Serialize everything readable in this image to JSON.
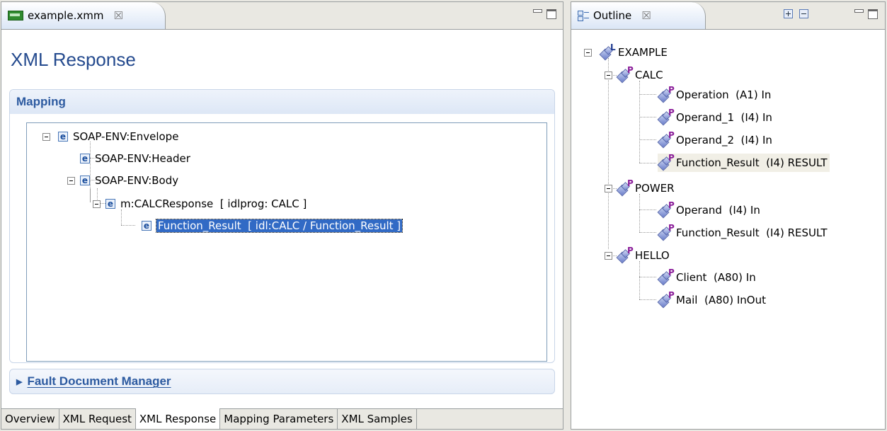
{
  "editor": {
    "tab_title": "example.xmm",
    "file_icon": "xml-mapping-file-icon",
    "form_title": "XML Response",
    "mapping_section": "Mapping",
    "fault_section": "Fault Document Manager",
    "tree": [
      {
        "label": "SOAP-ENV:Envelope"
      },
      {
        "label": "SOAP-ENV:Header"
      },
      {
        "label": "SOAP-ENV:Body"
      },
      {
        "label": "m:CALCResponse  [ idlprog: CALC ]"
      },
      {
        "label": "Function_Result  [ idl:CALC / Function_Result ]"
      }
    ],
    "bottom_tabs": [
      "Overview",
      "XML Request",
      "XML Response",
      "Mapping Parameters",
      "XML Samples"
    ],
    "active_bottom_tab": "XML Response"
  },
  "outline": {
    "tab_title": "Outline",
    "root": "EXAMPLE",
    "items": {
      "calc": "CALC",
      "calc_op": "Operation  (A1) In",
      "calc_o1": "Operand_1  (I4) In",
      "calc_o2": "Operand_2  (I4) In",
      "calc_fr": "Function_Result  (I4) RESULT",
      "power": "POWER",
      "power_op": "Operand  (I4) In",
      "power_fr": "Function_Result  (I4) RESULT",
      "hello": "HELLO",
      "hello_client": "Client  (A80) In",
      "hello_mail": "Mail  (A80) InOut"
    },
    "badges": {
      "library": "L",
      "program": "P"
    }
  },
  "colors": {
    "title": "#244a8e",
    "section_header": "#2c5aa0",
    "selection": "#316ac5",
    "program_badge": "#8a1c99"
  }
}
